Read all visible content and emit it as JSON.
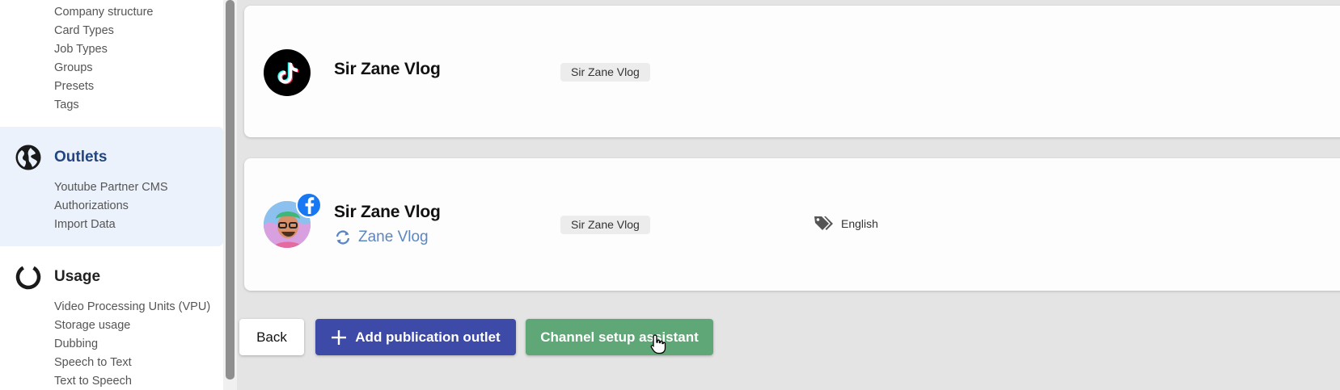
{
  "sidebar": {
    "settings_links": [
      "Company structure",
      "Card Types",
      "Job Types",
      "Groups",
      "Presets",
      "Tags"
    ],
    "outlets": {
      "title": "Outlets",
      "icon": "globe-icon",
      "links": [
        "Youtube Partner CMS",
        "Authorizations",
        "Import Data"
      ]
    },
    "usage": {
      "title": "Usage",
      "icon": "usage-ring-icon",
      "links": [
        "Video Processing Units (VPU)",
        "Storage usage",
        "Dubbing",
        "Speech to Text",
        "Text to Speech"
      ]
    }
  },
  "outlets_list": [
    {
      "platform_icon": "tiktok-icon",
      "name": "Sir Zane Vlog",
      "tag": "Sir Zane Vlog"
    },
    {
      "platform_icon": "facebook-icon",
      "name": "Sir Zane Vlog",
      "sync_label": "Zane Vlog",
      "tag": "Sir Zane Vlog",
      "language": "English"
    }
  ],
  "actions": {
    "back_label": "Back",
    "add_label": "Add publication outlet",
    "assistant_label": "Channel setup assistant"
  },
  "colors": {
    "accent_blue": "#3e4aa8",
    "accent_green": "#5fa777",
    "facebook_blue": "#1877f2",
    "outlets_title": "#23467e"
  }
}
